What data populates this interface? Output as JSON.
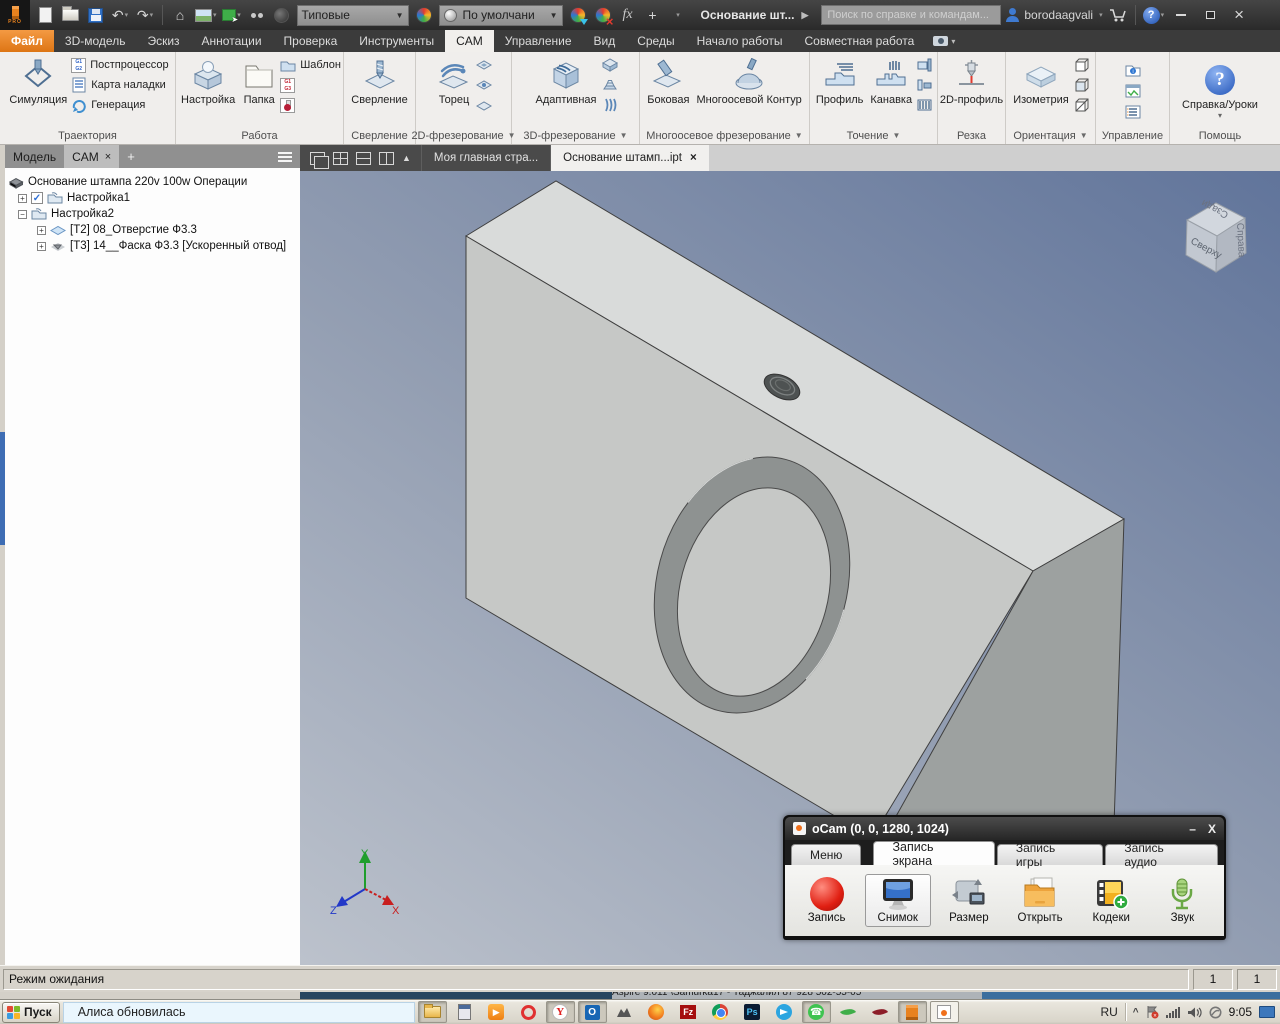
{
  "titlebar": {
    "logo": "PRO",
    "doc_title": "Основание шт...",
    "search_placeholder": "Поиск по справке и командам...",
    "username": "borodaagvali",
    "style_preset": "Типовые",
    "material_preset": "По умолчани",
    "fx": "fx"
  },
  "ribbon_tabs": [
    "Файл",
    "3D-модель",
    "Эскиз",
    "Аннотации",
    "Проверка",
    "Инструменты",
    "CAM",
    "Управление",
    "Вид",
    "Среды",
    "Начало работы",
    "Совместная работа"
  ],
  "ribbon": {
    "badges": {
      "g1": "G1",
      "g2": "G2",
      "g3": "G3"
    },
    "trajectory": {
      "label": "Траектория",
      "simulate": "Симуляция",
      "post": "Постпроцессор",
      "setup_sheet": "Карта наладки",
      "generate": "Генерация"
    },
    "job": {
      "label": "Работа",
      "setup": "Настройка",
      "folder": "Папка",
      "pattern": "Шаблон"
    },
    "drilling": {
      "label": "Сверление",
      "drill": "Сверление"
    },
    "milling2d": {
      "label": "2D-фрезерование",
      "face": "Торец"
    },
    "milling3d": {
      "label": "3D-фрезерование",
      "adaptive": "Адаптивная"
    },
    "multiaxis": {
      "label": "Многоосевое фрезерование",
      "swarf": "Боковая",
      "contour": "Многоосевой Контур"
    },
    "turning": {
      "label": "Точение",
      "profile": "Профиль",
      "groove": "Канавка"
    },
    "cutting": {
      "label": "Резка",
      "profile2d": "2D-профиль"
    },
    "orientation": {
      "label": "Ориентация",
      "isometric": "Изометрия"
    },
    "manage": {
      "label": "Управление"
    },
    "help": {
      "label": "Помощь",
      "help_button": "Справка/Уроки"
    }
  },
  "browser": {
    "tab_model": "Модель",
    "tab_cam": "CAM",
    "root": "Основание штампа 220v 100w Операции",
    "setup1": "Настройка1",
    "setup2": "Настройка2",
    "op1": "[T2] 08_Отверстие Ф3.3",
    "op2": "[T3] 14__Фаска Ф3.3 [Ускоренный отвод]"
  },
  "viewport": {
    "viewcube_front": "Сверху",
    "viewcube_right": "Справа",
    "viewcube_top": "Сзади",
    "axis_x": "X",
    "axis_y": "Y",
    "axis_z": "Z"
  },
  "doc_tabs": {
    "home": "Моя главная стра...",
    "part": "Основание штамп...ipt"
  },
  "statusbar": {
    "message": "Режим ожидания",
    "field1": "1",
    "field2": "1"
  },
  "background_window": {
    "title": "Aspire 9.011 \\Samurka17 - Таджалил 87 928 502-55-05"
  },
  "ocam": {
    "title": "oCam (0, 0, 1280, 1024)",
    "tab_menu": "Меню",
    "tab_screen": "Запись экрана",
    "tab_game": "Запись игры",
    "tab_audio": "Запись аудио",
    "btn_record": "Запись",
    "btn_snapshot": "Снимок",
    "btn_size": "Размер",
    "btn_open": "Открыть",
    "btn_codecs": "Кодеки",
    "btn_sound": "Звук"
  },
  "taskbar": {
    "start": "Пуск",
    "alice": "Алиса обновилась",
    "lang": "RU",
    "time": "9:05"
  }
}
